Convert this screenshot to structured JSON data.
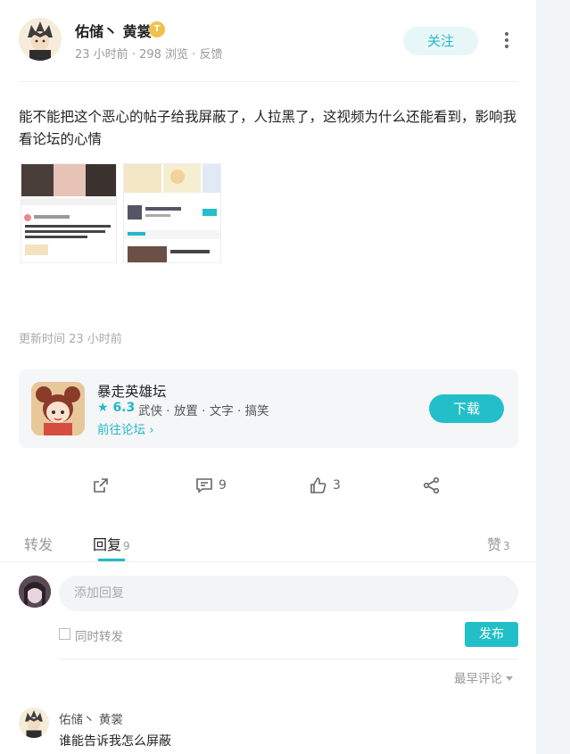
{
  "post": {
    "author": "佑储丶 黄裳",
    "badge": "T",
    "time": "23 小时前",
    "views": "298 浏览",
    "feedback": "反馈",
    "follow_label": "关注",
    "text": "能不能把这个恶心的帖子给我屏蔽了，人拉黑了，这视频为什么还能看到，影响我看论坛的心情",
    "update_time": "更新时间 23 小时前"
  },
  "app_card": {
    "name": "暴走英雄坛",
    "rating": "6.3",
    "tags": "武侠 · 放置 · 文字 · 搞笑",
    "link": "前往论坛",
    "download_label": "下载"
  },
  "actions": {
    "comments": "9",
    "likes": "3"
  },
  "tabs": [
    {
      "label": "转发",
      "count": ""
    },
    {
      "label": "回复",
      "count": "9"
    },
    {
      "label": "赞",
      "count": "3"
    }
  ],
  "compose": {
    "placeholder": "添加回复",
    "repost_label": "同时转发",
    "publish_label": "发布"
  },
  "sort": {
    "label": "最早评论"
  },
  "comments": [
    {
      "author": "佑储丶 黄裳",
      "text": "谁能告诉我怎么屏蔽"
    }
  ],
  "colors": {
    "accent": "#23b8c7",
    "rating": "#23b8c7"
  }
}
